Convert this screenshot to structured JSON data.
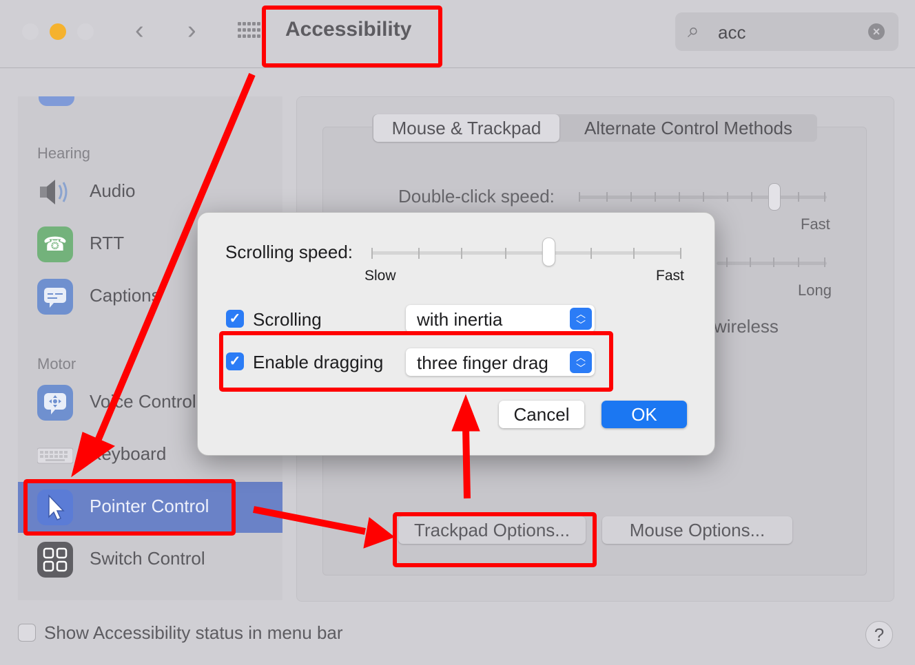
{
  "window": {
    "title": "Accessibility",
    "traffic_lights": [
      "#d4d3d8",
      "#f5b22e",
      "#d4d3d8"
    ],
    "nav_back_icon": "chevron-left-icon",
    "nav_forward_icon": "chevron-right-icon",
    "grid_icon": "show-all-grid-icon"
  },
  "search": {
    "value": "acc",
    "icon": "search-icon",
    "clear_icon": "clear-icon"
  },
  "sidebar": {
    "sections": [
      {
        "header": "Hearing"
      },
      {
        "header": "Motor"
      }
    ],
    "items": [
      {
        "label": "Audio",
        "icon": "speaker-icon"
      },
      {
        "label": "RTT",
        "icon": "telephone-icon"
      },
      {
        "label": "Captions",
        "icon": "captions-icon"
      },
      {
        "label": "Voice Control",
        "icon": "voice-control-icon"
      },
      {
        "label": "Keyboard",
        "icon": "keyboard-icon"
      },
      {
        "label": "Pointer Control",
        "icon": "pointer-icon",
        "selected": true
      },
      {
        "label": "Switch Control",
        "icon": "switch-control-icon"
      }
    ]
  },
  "tabs": [
    "Mouse & Trackpad",
    "Alternate Control Methods"
  ],
  "background_content": {
    "double_click_label": "Double-click speed:",
    "fast_label": "Fast",
    "long_label": "Long",
    "wireless_fragment": "wireless",
    "trackpad_options_button": "Trackpad Options...",
    "mouse_options_button": "Mouse Options..."
  },
  "footer": {
    "status_checkbox_label": "Show Accessibility status in menu bar",
    "status_checked": false,
    "help_label": "?"
  },
  "dialog": {
    "scrolling_speed_label": "Scrolling speed:",
    "slow_label": "Slow",
    "fast_label": "Fast",
    "scrolling_speed_value_fraction": 0.58,
    "scrolling": {
      "label": "Scrolling",
      "checked": true,
      "option": "with inertia"
    },
    "dragging": {
      "label": "Enable dragging",
      "checked": true,
      "option": "three finger drag"
    },
    "cancel_label": "Cancel",
    "ok_label": "OK",
    "accent_color": "#2b7cf6"
  },
  "annotations": {
    "highlight_color": "#ff0000"
  }
}
